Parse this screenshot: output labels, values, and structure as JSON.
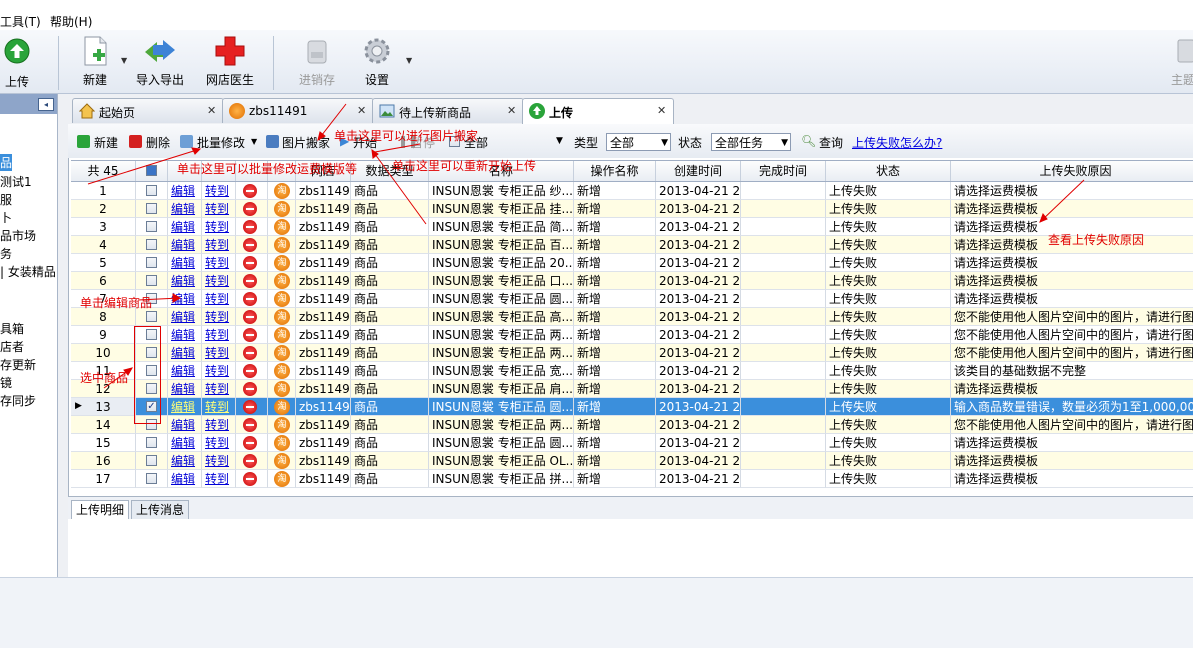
{
  "menu": {
    "tools": "工具(T)",
    "help": "帮助(H)"
  },
  "toolbar": {
    "upload": "上传",
    "new": "新建",
    "import_export": "导入导出",
    "shop_doctor": "网店医生",
    "inventory": "进销存",
    "settings": "设置",
    "theme": "主题"
  },
  "left_panel": {
    "items": [
      "品",
      "测试1",
      "服",
      "卜",
      "品市场",
      "务",
      "| 女装精品",
      "具箱",
      "店者",
      "存更新",
      "镜",
      "存同步"
    ]
  },
  "tabs": [
    {
      "label": "起始页"
    },
    {
      "label": "zbs11491"
    },
    {
      "label": "待上传新商品"
    },
    {
      "label": "上传"
    }
  ],
  "subtoolbar": {
    "new": "新建",
    "delete": "删除",
    "batch_edit": "批量修改",
    "image_move": "图片搬家",
    "start": "开始",
    "pause": "暂停",
    "all": "全部",
    "type_label": "类型",
    "type_value": "全部",
    "status_label": "状态",
    "status_value": "全部任务",
    "query": "查询",
    "help_link": "上传失败怎么办?"
  },
  "grid": {
    "headers": [
      "共 45",
      "",
      "",
      "",
      "",
      "",
      "网店",
      "数据类型",
      "名称",
      "操作名称",
      "创建时间",
      "完成时间",
      "状态",
      "上传失败原因"
    ],
    "edit_label": "编辑",
    "goto_label": "转到",
    "tao_label": "淘",
    "rows": [
      {
        "n": "1",
        "shop": "zbs11491",
        "dtype": "商品",
        "name": "INSUN恩裳 专柜正品 纱...",
        "op": "新增",
        "created": "2013-04-21 2...",
        "done": "",
        "status": "上传失败",
        "reason": "请选择运费模板",
        "checked": false
      },
      {
        "n": "2",
        "shop": "zbs11491",
        "dtype": "商品",
        "name": "INSUN恩裳 专柜正品 挂...",
        "op": "新增",
        "created": "2013-04-21 2...",
        "done": "",
        "status": "上传失败",
        "reason": "请选择运费模板",
        "checked": false
      },
      {
        "n": "3",
        "shop": "zbs11491",
        "dtype": "商品",
        "name": "INSUN恩裳 专柜正品 简...",
        "op": "新增",
        "created": "2013-04-21 2...",
        "done": "",
        "status": "上传失败",
        "reason": "请选择运费模板",
        "checked": false
      },
      {
        "n": "4",
        "shop": "zbs11491",
        "dtype": "商品",
        "name": "INSUN恩裳 专柜正品 百...",
        "op": "新增",
        "created": "2013-04-21 2...",
        "done": "",
        "status": "上传失败",
        "reason": "请选择运费模板",
        "checked": false
      },
      {
        "n": "5",
        "shop": "zbs11491",
        "dtype": "商品",
        "name": "INSUN恩裳 专柜正品 20...",
        "op": "新增",
        "created": "2013-04-21 2...",
        "done": "",
        "status": "上传失败",
        "reason": "请选择运费模板",
        "checked": false
      },
      {
        "n": "6",
        "shop": "zbs11491",
        "dtype": "商品",
        "name": "INSUN恩裳 专柜正品 口...",
        "op": "新增",
        "created": "2013-04-21 2...",
        "done": "",
        "status": "上传失败",
        "reason": "请选择运费模板",
        "checked": false
      },
      {
        "n": "7",
        "shop": "zbs11491",
        "dtype": "商品",
        "name": "INSUN恩裳 专柜正品 圆...",
        "op": "新增",
        "created": "2013-04-21 2...",
        "done": "",
        "status": "上传失败",
        "reason": "请选择运费模板",
        "checked": false
      },
      {
        "n": "8",
        "shop": "zbs11491",
        "dtype": "商品",
        "name": "INSUN恩裳 专柜正品 高...",
        "op": "新增",
        "created": "2013-04-21 2...",
        "done": "",
        "status": "上传失败",
        "reason": "您不能使用他人图片空间中的图片，请进行图",
        "checked": false
      },
      {
        "n": "9",
        "shop": "zbs11491",
        "dtype": "商品",
        "name": "INSUN恩裳 专柜正品 两...",
        "op": "新增",
        "created": "2013-04-21 2...",
        "done": "",
        "status": "上传失败",
        "reason": "您不能使用他人图片空间中的图片，请进行图",
        "checked": false
      },
      {
        "n": "10",
        "shop": "zbs11491",
        "dtype": "商品",
        "name": "INSUN恩裳 专柜正品 两...",
        "op": "新增",
        "created": "2013-04-21 2...",
        "done": "",
        "status": "上传失败",
        "reason": "您不能使用他人图片空间中的图片，请进行图",
        "checked": false
      },
      {
        "n": "11",
        "shop": "zbs11491",
        "dtype": "商品",
        "name": "INSUN恩裳 专柜正品 宽...",
        "op": "新增",
        "created": "2013-04-21 2...",
        "done": "",
        "status": "上传失败",
        "reason": "该类目的基础数据不完整",
        "checked": false
      },
      {
        "n": "12",
        "shop": "zbs11491",
        "dtype": "商品",
        "name": "INSUN恩裳 专柜正品 肩...",
        "op": "新增",
        "created": "2013-04-21 2...",
        "done": "",
        "status": "上传失败",
        "reason": "请选择运费模板",
        "checked": false
      },
      {
        "n": "13",
        "shop": "zbs11491",
        "dtype": "商品",
        "name": "INSUN恩裳 专柜正品 圆...",
        "op": "新增",
        "created": "2013-04-21 2...",
        "done": "",
        "status": "上传失败",
        "reason": "输入商品数量错误，数量必须为1至1,000,000之",
        "checked": true
      },
      {
        "n": "14",
        "shop": "zbs11491",
        "dtype": "商品",
        "name": "INSUN恩裳 专柜正品 两...",
        "op": "新增",
        "created": "2013-04-21 2...",
        "done": "",
        "status": "上传失败",
        "reason": "您不能使用他人图片空间中的图片，请进行图",
        "checked": false
      },
      {
        "n": "15",
        "shop": "zbs11491",
        "dtype": "商品",
        "name": "INSUN恩裳 专柜正品 圆...",
        "op": "新增",
        "created": "2013-04-21 2...",
        "done": "",
        "status": "上传失败",
        "reason": "请选择运费模板",
        "checked": false
      },
      {
        "n": "16",
        "shop": "zbs11491",
        "dtype": "商品",
        "name": "INSUN恩裳 专柜正品 OL...",
        "op": "新增",
        "created": "2013-04-21 2...",
        "done": "",
        "status": "上传失败",
        "reason": "请选择运费模板",
        "checked": false
      },
      {
        "n": "17",
        "shop": "zbs11491",
        "dtype": "商品",
        "name": "INSUN恩裳 专柜正品 拼...",
        "op": "新增",
        "created": "2013-04-21 2...",
        "done": "",
        "status": "上传失败",
        "reason": "请选择运费模板",
        "checked": false
      }
    ]
  },
  "bottom_tabs": [
    "上传明细",
    "上传消息"
  ],
  "annotations": {
    "image_move": "单击这里可以进行图片搬家",
    "batch_edit": "单击这里可以批量修改运费模版等",
    "restart": "单击这里可以重新开始上传",
    "failure_reason": "查看上传失败原因",
    "edit_item": "单击编辑商品",
    "select_item": "选中商品"
  },
  "colors": {
    "selected_row": "#3b8fdc",
    "alt_row": "#fffde4",
    "annotation": "#e00000"
  }
}
